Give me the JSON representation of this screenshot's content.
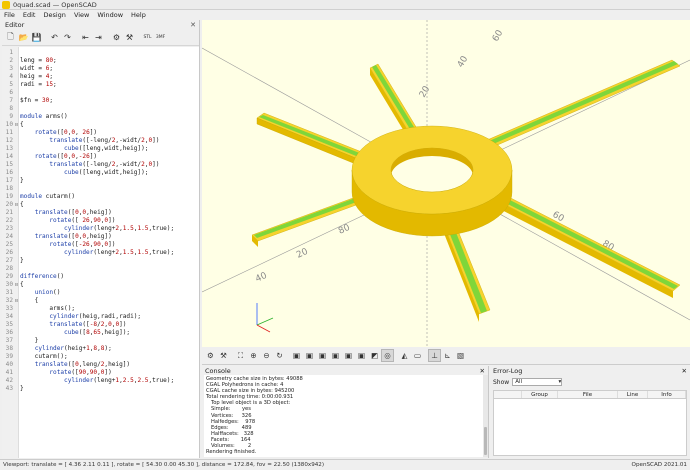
{
  "window": {
    "title": "0quad.scad — OpenSCAD"
  },
  "menu": [
    "File",
    "Edit",
    "Design",
    "View",
    "Window",
    "Help"
  ],
  "editor": {
    "title": "Editor",
    "close": "✕",
    "toolbar": [
      {
        "name": "new-file-icon",
        "glyph": "🗋"
      },
      {
        "name": "open-file-icon",
        "glyph": "📂"
      },
      {
        "name": "save-file-icon",
        "glyph": "💾"
      },
      {
        "name": "undo-icon",
        "glyph": "↶"
      },
      {
        "name": "redo-icon",
        "glyph": "↷"
      },
      {
        "name": "unindent-icon",
        "glyph": "⇤"
      },
      {
        "name": "indent-icon",
        "glyph": "⇥"
      },
      {
        "name": "preview-icon",
        "glyph": "⚙"
      },
      {
        "name": "render-icon",
        "glyph": "⚒"
      },
      {
        "name": "export-stl-icon",
        "glyph": "STL"
      },
      {
        "name": "export-3mf-icon",
        "glyph": "3MF"
      }
    ],
    "lines": [
      {
        "n": "1",
        "t": "",
        "f": ""
      },
      {
        "n": "2",
        "t": "leng = 80;",
        "f": ""
      },
      {
        "n": "3",
        "t": "widt = 6;",
        "f": ""
      },
      {
        "n": "4",
        "t": "heig = 4;",
        "f": ""
      },
      {
        "n": "5",
        "t": "radi = 15;",
        "f": ""
      },
      {
        "n": "6",
        "t": "",
        "f": ""
      },
      {
        "n": "7",
        "t": "$fn = 30;",
        "f": ""
      },
      {
        "n": "8",
        "t": "",
        "f": ""
      },
      {
        "n": "9",
        "t": "module arms()",
        "f": ""
      },
      {
        "n": "10",
        "t": "{",
        "f": "⊟"
      },
      {
        "n": "11",
        "t": "    rotate([0,0, 26])",
        "f": ""
      },
      {
        "n": "12",
        "t": "        translate([-leng/2,-widt/2,0])",
        "f": ""
      },
      {
        "n": "13",
        "t": "            cube([leng,widt,heig]);",
        "f": ""
      },
      {
        "n": "14",
        "t": "    rotate([0,0,-26])",
        "f": ""
      },
      {
        "n": "15",
        "t": "        translate([-leng/2,-widt/2,0])",
        "f": ""
      },
      {
        "n": "16",
        "t": "            cube([leng,widt,heig]);",
        "f": ""
      },
      {
        "n": "17",
        "t": "}",
        "f": ""
      },
      {
        "n": "18",
        "t": "",
        "f": ""
      },
      {
        "n": "19",
        "t": "module cutarm()",
        "f": ""
      },
      {
        "n": "20",
        "t": "{",
        "f": "⊟"
      },
      {
        "n": "21",
        "t": "    translate([0,0,heig])",
        "f": ""
      },
      {
        "n": "22",
        "t": "        rotate([ 26,90,0])",
        "f": ""
      },
      {
        "n": "23",
        "t": "            cylinder(leng+2,1.5,1.5,true);",
        "f": ""
      },
      {
        "n": "24",
        "t": "    translate([0,0,heig])",
        "f": ""
      },
      {
        "n": "25",
        "t": "        rotate([-26,90,0])",
        "f": ""
      },
      {
        "n": "26",
        "t": "            cylinder(leng+2,1.5,1.5,true);",
        "f": ""
      },
      {
        "n": "27",
        "t": "}",
        "f": ""
      },
      {
        "n": "28",
        "t": "",
        "f": ""
      },
      {
        "n": "29",
        "t": "difference()",
        "f": ""
      },
      {
        "n": "30",
        "t": "{",
        "f": "⊟"
      },
      {
        "n": "31",
        "t": "    union()",
        "f": ""
      },
      {
        "n": "32",
        "t": "    {",
        "f": "⊟"
      },
      {
        "n": "33",
        "t": "        arms();",
        "f": ""
      },
      {
        "n": "34",
        "t": "        cylinder(heig,radi,radi);",
        "f": ""
      },
      {
        "n": "35",
        "t": "        translate([-8/2,0,0])",
        "f": ""
      },
      {
        "n": "36",
        "t": "            cube([8,65,heig]);",
        "f": ""
      },
      {
        "n": "37",
        "t": "    }",
        "f": ""
      },
      {
        "n": "38",
        "t": "    cylinder(heig+1,8,8);",
        "f": ""
      },
      {
        "n": "39",
        "t": "    cutarm();",
        "f": ""
      },
      {
        "n": "40",
        "t": "    translate([0,leng/2,heig])",
        "f": ""
      },
      {
        "n": "41",
        "t": "        rotate([90,90,0])",
        "f": ""
      },
      {
        "n": "42",
        "t": "            cylinder(leng+1,2.5,2.5,true);",
        "f": ""
      },
      {
        "n": "43",
        "t": "}",
        "f": ""
      }
    ]
  },
  "viewport": {
    "background": "#ffffe5",
    "part_color": "#f6d32d",
    "part_dark": "#e0b800",
    "groove_color": "#7fd63a",
    "axis_labels": [
      "20",
      "40",
      "60",
      "80",
      "20",
      "40",
      "60",
      "80"
    ]
  },
  "viewport_toolbar": [
    {
      "name": "preview-icon",
      "glyph": "⚙"
    },
    {
      "name": "render-icon",
      "glyph": "⚒"
    },
    {
      "name": "view-all-icon",
      "glyph": "⛶"
    },
    {
      "name": "zoom-in-icon",
      "glyph": "⊕"
    },
    {
      "name": "zoom-out-icon",
      "glyph": "⊖"
    },
    {
      "name": "reset-view-icon",
      "glyph": "↻"
    },
    {
      "name": "view-right-icon",
      "glyph": "▣"
    },
    {
      "name": "view-top-icon",
      "glyph": "▣"
    },
    {
      "name": "view-bottom-icon",
      "glyph": "▣"
    },
    {
      "name": "view-left-icon",
      "glyph": "▣"
    },
    {
      "name": "view-front-icon",
      "glyph": "▣"
    },
    {
      "name": "view-back-icon",
      "glyph": "▣"
    },
    {
      "name": "view-diagonal-icon",
      "glyph": "◩"
    },
    {
      "name": "view-center-icon",
      "glyph": "◎"
    },
    {
      "name": "perspective-icon",
      "glyph": "◭"
    },
    {
      "name": "orthogonal-icon",
      "glyph": "▭"
    },
    {
      "name": "show-axes-icon",
      "glyph": "⊥"
    },
    {
      "name": "show-scale-icon",
      "glyph": "⊾"
    },
    {
      "name": "show-edges-icon",
      "glyph": "▧"
    }
  ],
  "console": {
    "title": "Console",
    "lines": [
      "Geometry cache size in bytes: 49088",
      "CGAL Polyhedrons in cache: 4",
      "CGAL cache size in bytes: 945200",
      "Total rendering time: 0:00:00.931",
      "   Top level object is a 3D object:",
      "   Simple:       yes",
      "   Vertices:     326",
      "   Halfedges:    978",
      "   Edges:        489",
      "   Halffacets:   328",
      "   Facets:       164",
      "   Volumes:        2",
      "Rendering finished."
    ]
  },
  "errorlog": {
    "title": "Error-Log",
    "show_label": "Show",
    "show_value": "All",
    "columns": [
      "Group",
      "File",
      "Line",
      "Info"
    ]
  },
  "status": {
    "left": "Viewport: translate = [ 4.36 2.11 0.11 ], rotate = [ 54.30 0.00 45.30 ], distance = 172.84, fov = 22.50 (1380x942)",
    "right": "OpenSCAD 2021.01"
  }
}
